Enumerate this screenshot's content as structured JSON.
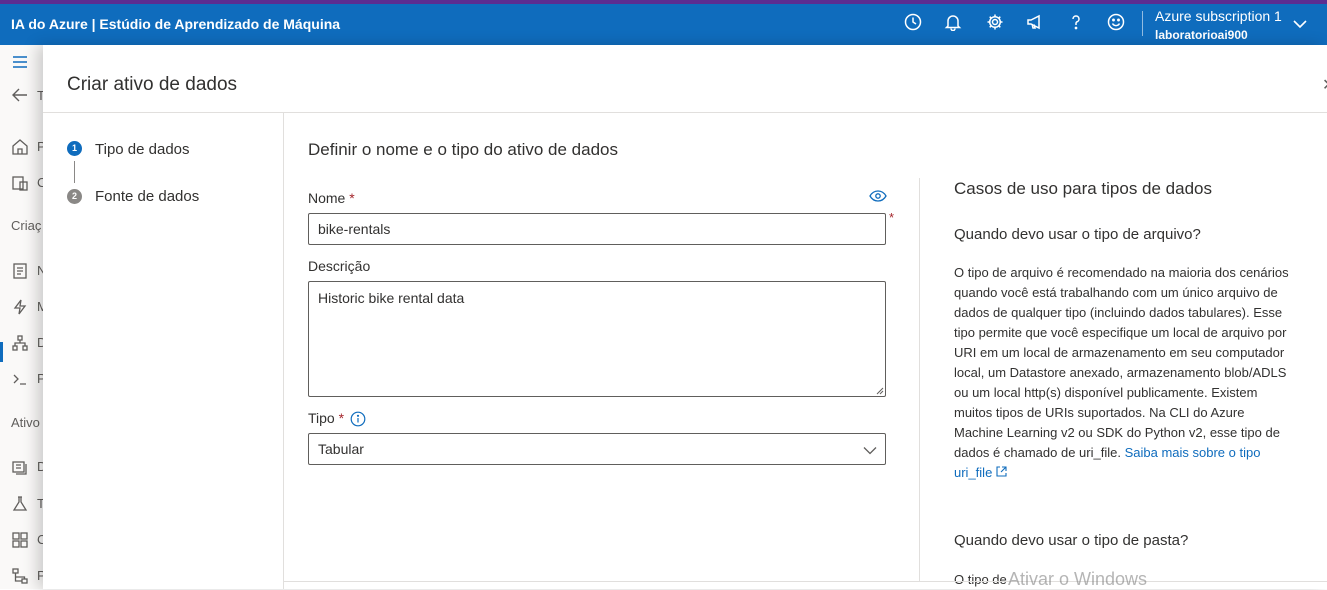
{
  "topbar": {
    "app_title": "IA do Azure | Estúdio de Aprendizado de Máquina",
    "subscription": "Azure subscription 1",
    "workspace": "laboratorioai900",
    "icons": [
      "clock-icon",
      "bell-icon",
      "gear-icon",
      "megaphone-icon",
      "help-icon",
      "smiley-icon",
      "chevron-down-icon"
    ]
  },
  "leftnav": {
    "items": [
      {
        "icon": "hamburger-icon",
        "label": ""
      },
      {
        "icon": "back-arrow-icon",
        "label": "T"
      },
      {
        "icon": "home-icon",
        "label": "P"
      },
      {
        "icon": "catalog-icon",
        "label": "C"
      },
      {
        "icon": "notebook-icon",
        "label": "N"
      },
      {
        "icon": "automl-icon",
        "label": "M"
      },
      {
        "icon": "designer-icon",
        "label": "D"
      },
      {
        "icon": "prompt-icon",
        "label": "P"
      },
      {
        "icon": "data-icon",
        "label": "D"
      },
      {
        "icon": "jobs-icon",
        "label": "T"
      },
      {
        "icon": "components-icon",
        "label": "C"
      },
      {
        "icon": "pipelines-icon",
        "label": "P"
      }
    ],
    "sections": [
      "Criaç",
      "Ativo"
    ]
  },
  "panel": {
    "title": "Criar ativo de dados",
    "steps": [
      {
        "number": "1",
        "label": "Tipo de dados",
        "active": true
      },
      {
        "number": "2",
        "label": "Fonte de dados",
        "active": false
      }
    ],
    "form": {
      "heading": "Definir o nome e o tipo do ativo de dados",
      "name_label": "Nome",
      "name_value": "bike-rentals",
      "description_label": "Descrição",
      "description_value": "Historic bike rental data",
      "type_label": "Tipo",
      "type_value": "Tabular",
      "required_mark": "*"
    },
    "help": {
      "title": "Casos de uso para tipos de dados",
      "q1": "Quando devo usar o tipo de arquivo?",
      "body": "O tipo de arquivo é recomendado na maioria dos cenários quando você está trabalhando com um único arquivo de dados de qualquer tipo (incluindo dados tabulares). Esse tipo permite que você especifique um local de arquivo por URI em um local de armazenamento em seu computador local, um Datastore anexado, armazenamento blob/ADLS ou um local http(s) disponível publicamente. Existem muitos tipos de URIs suportados. Na CLI do Azure Machine Learning v2 ou SDK do Python v2, esse tipo de dados é chamado de uri_file.",
      "link": "Saiba mais sobre o tipo uri_file",
      "q2": "Quando devo usar o tipo de pasta?",
      "cut_text": "O tipo de"
    },
    "watermark": "Ativar o Windows"
  },
  "colors": {
    "topbar": "#0f6cbd",
    "accent": "#0f6cbd",
    "required": "#a4262c"
  }
}
